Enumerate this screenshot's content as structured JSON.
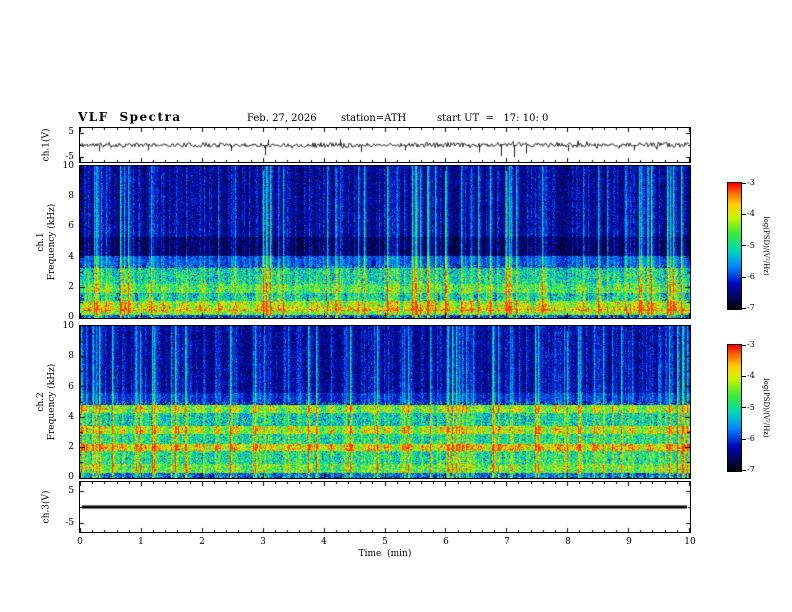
{
  "header": {
    "title": "VLF Spectra",
    "date": "Feb. 27, 2026",
    "station": "station=ATH",
    "start_ut": "start UT  =   17: 10: 0"
  },
  "time_axis": {
    "label": "Time  (min)",
    "ticks": [
      "0",
      "1",
      "2",
      "3",
      "4",
      "5",
      "6",
      "7",
      "8",
      "9",
      "10"
    ],
    "range_min": [
      0,
      10
    ]
  },
  "colorbar": {
    "label": "log(PSD)/(V²/Hz)",
    "ticks": [
      "-3",
      "-4",
      "-5",
      "-6",
      "-7"
    ],
    "range_log_psd": [
      -7,
      -3
    ]
  },
  "chart_data": [
    {
      "type": "line",
      "name": "ch.1 voltage time series",
      "ylabel": "ch.1(V)",
      "ylim": [
        -5,
        5
      ],
      "plot_vrange": 7,
      "ytick_labels": [
        "5",
        "-5"
      ],
      "x_range_min": [
        0,
        10
      ],
      "seed": 11,
      "series": [
        {
          "name": "ch.1",
          "description": "broadband noise about 0 V (~±1 V) with impulsive spikes",
          "noise_amplitude_V": 1.1,
          "spikes": [
            {
              "t_min": 0.32,
              "v": -2.6
            },
            {
              "t_min": 1.12,
              "v": -2.2
            },
            {
              "t_min": 2.48,
              "v": -2.4
            },
            {
              "t_min": 3.03,
              "v": -4.2
            },
            {
              "t_min": 3.08,
              "v": 2.2
            },
            {
              "t_min": 4.27,
              "v": 2.3
            },
            {
              "t_min": 4.62,
              "v": -2.8
            },
            {
              "t_min": 5.34,
              "v": -2.2
            },
            {
              "t_min": 6.55,
              "v": -3.0
            },
            {
              "t_min": 6.92,
              "v": -4.6
            },
            {
              "t_min": 7.12,
              "v": -5.0
            },
            {
              "t_min": 7.33,
              "v": -3.4
            },
            {
              "t_min": 8.02,
              "v": -2.5
            },
            {
              "t_min": 9.1,
              "v": -2.2
            }
          ]
        }
      ]
    },
    {
      "type": "heatmap",
      "name": "ch.1 spectrogram",
      "ylabel": "ch.1  Frequency (kHz)",
      "ylabel_channel": "ch.1",
      "ylabel_axis": "Frequency  (kHz)",
      "ylim_kHz": [
        0,
        10
      ],
      "ytick_labels": [
        "10",
        "8",
        "6",
        "4",
        "2",
        "0"
      ],
      "x_range_min": [
        0,
        10
      ],
      "zlabel": "log(PSD)/(V²/Hz)",
      "zlim": [
        -7,
        -3
      ],
      "seed": 42,
      "profile": [
        [
          0,
          0.15,
          0.22
        ],
        [
          0.15,
          0.55,
          0.6
        ],
        [
          0.55,
          1.1,
          0.52
        ],
        [
          1.1,
          1.6,
          0.34
        ],
        [
          1.6,
          2.2,
          0.5
        ],
        [
          2.2,
          3.3,
          0.42
        ],
        [
          3.3,
          4.1,
          0.24
        ],
        [
          4.1,
          5.3,
          0.07
        ],
        [
          5.3,
          10.01,
          0.13
        ]
      ],
      "bursts": {
        "period_min": 0.31,
        "f_base_kHz": 0.7,
        "f_peak_kHz": 3.5,
        "gain": 0.26
      },
      "streaks": {
        "strong_density": 0.1,
        "strong_gain": [
          0.25,
          0.6
        ],
        "weak_density": 0.28,
        "weak_gain": [
          0.05,
          0.2
        ]
      },
      "noise_gain": 0.09,
      "lowfreq_speckle": {
        "below_kHz": 3.5,
        "gain": 0.18
      },
      "description": "dense vertical sferic streaks; very dark quiet band 4.1–5.3 kHz; broadband activity below ~3.5 kHz with quasi-periodic triangular bursts peaking near 3.5 kHz"
    },
    {
      "type": "heatmap",
      "name": "ch.2 spectrogram",
      "ylabel": "ch.2  Frequency (kHz)",
      "ylabel_channel": "ch.2",
      "ylabel_axis": "Frequency  (kHz)",
      "ylim_kHz": [
        0,
        10
      ],
      "ytick_labels": [
        "10",
        "8",
        "6",
        "4",
        "2",
        "0"
      ],
      "x_range_min": [
        0,
        10
      ],
      "zlabel": "log(PSD)/(V²/Hz)",
      "zlim": [
        -7,
        -3
      ],
      "seed": 77,
      "profile": [
        [
          0,
          0.3,
          0.26
        ],
        [
          0.3,
          0.9,
          0.56
        ],
        [
          0.9,
          1.75,
          0.46
        ],
        [
          1.75,
          2.2,
          0.66
        ],
        [
          2.2,
          2.85,
          0.46
        ],
        [
          2.85,
          3.4,
          0.58
        ],
        [
          3.4,
          4.25,
          0.42
        ],
        [
          4.25,
          4.8,
          0.54
        ],
        [
          4.8,
          5.6,
          0.2
        ],
        [
          5.6,
          10.01,
          0.14
        ]
      ],
      "band_modulation": {
        "period_min": 0.31,
        "gain": 0.14,
        "bands": [
          [
            1.75,
            2.2
          ],
          [
            2.85,
            3.4
          ],
          [
            4.25,
            4.8
          ]
        ]
      },
      "streaks": {
        "strong_density": 0.1,
        "strong_gain": [
          0.25,
          0.6
        ],
        "weak_density": 0.28,
        "weak_gain": [
          0.05,
          0.2
        ]
      },
      "noise_gain": 0.09,
      "lowfreq_speckle": {
        "below_kHz": 5.0,
        "gain": 0.18
      },
      "description": "vertical sferic streaks above quiet 4.8–5.6 kHz region; bright quasi-periodic horizontal bands near 2, 3 and 4.5 kHz; strong broadband activity below ~5 kHz"
    },
    {
      "type": "line",
      "name": "ch.3 voltage time series",
      "ylabel": "ch.3(V)",
      "ylim": [
        -5,
        5
      ],
      "plot_vrange": 8,
      "ytick_labels": [
        "5",
        "-5"
      ],
      "x_range_min": [
        0,
        10
      ],
      "series": [
        {
          "name": "ch.3",
          "description": "constant 0 V (flat thick trace, channel inactive)",
          "constant_V": 0
        }
      ]
    }
  ]
}
